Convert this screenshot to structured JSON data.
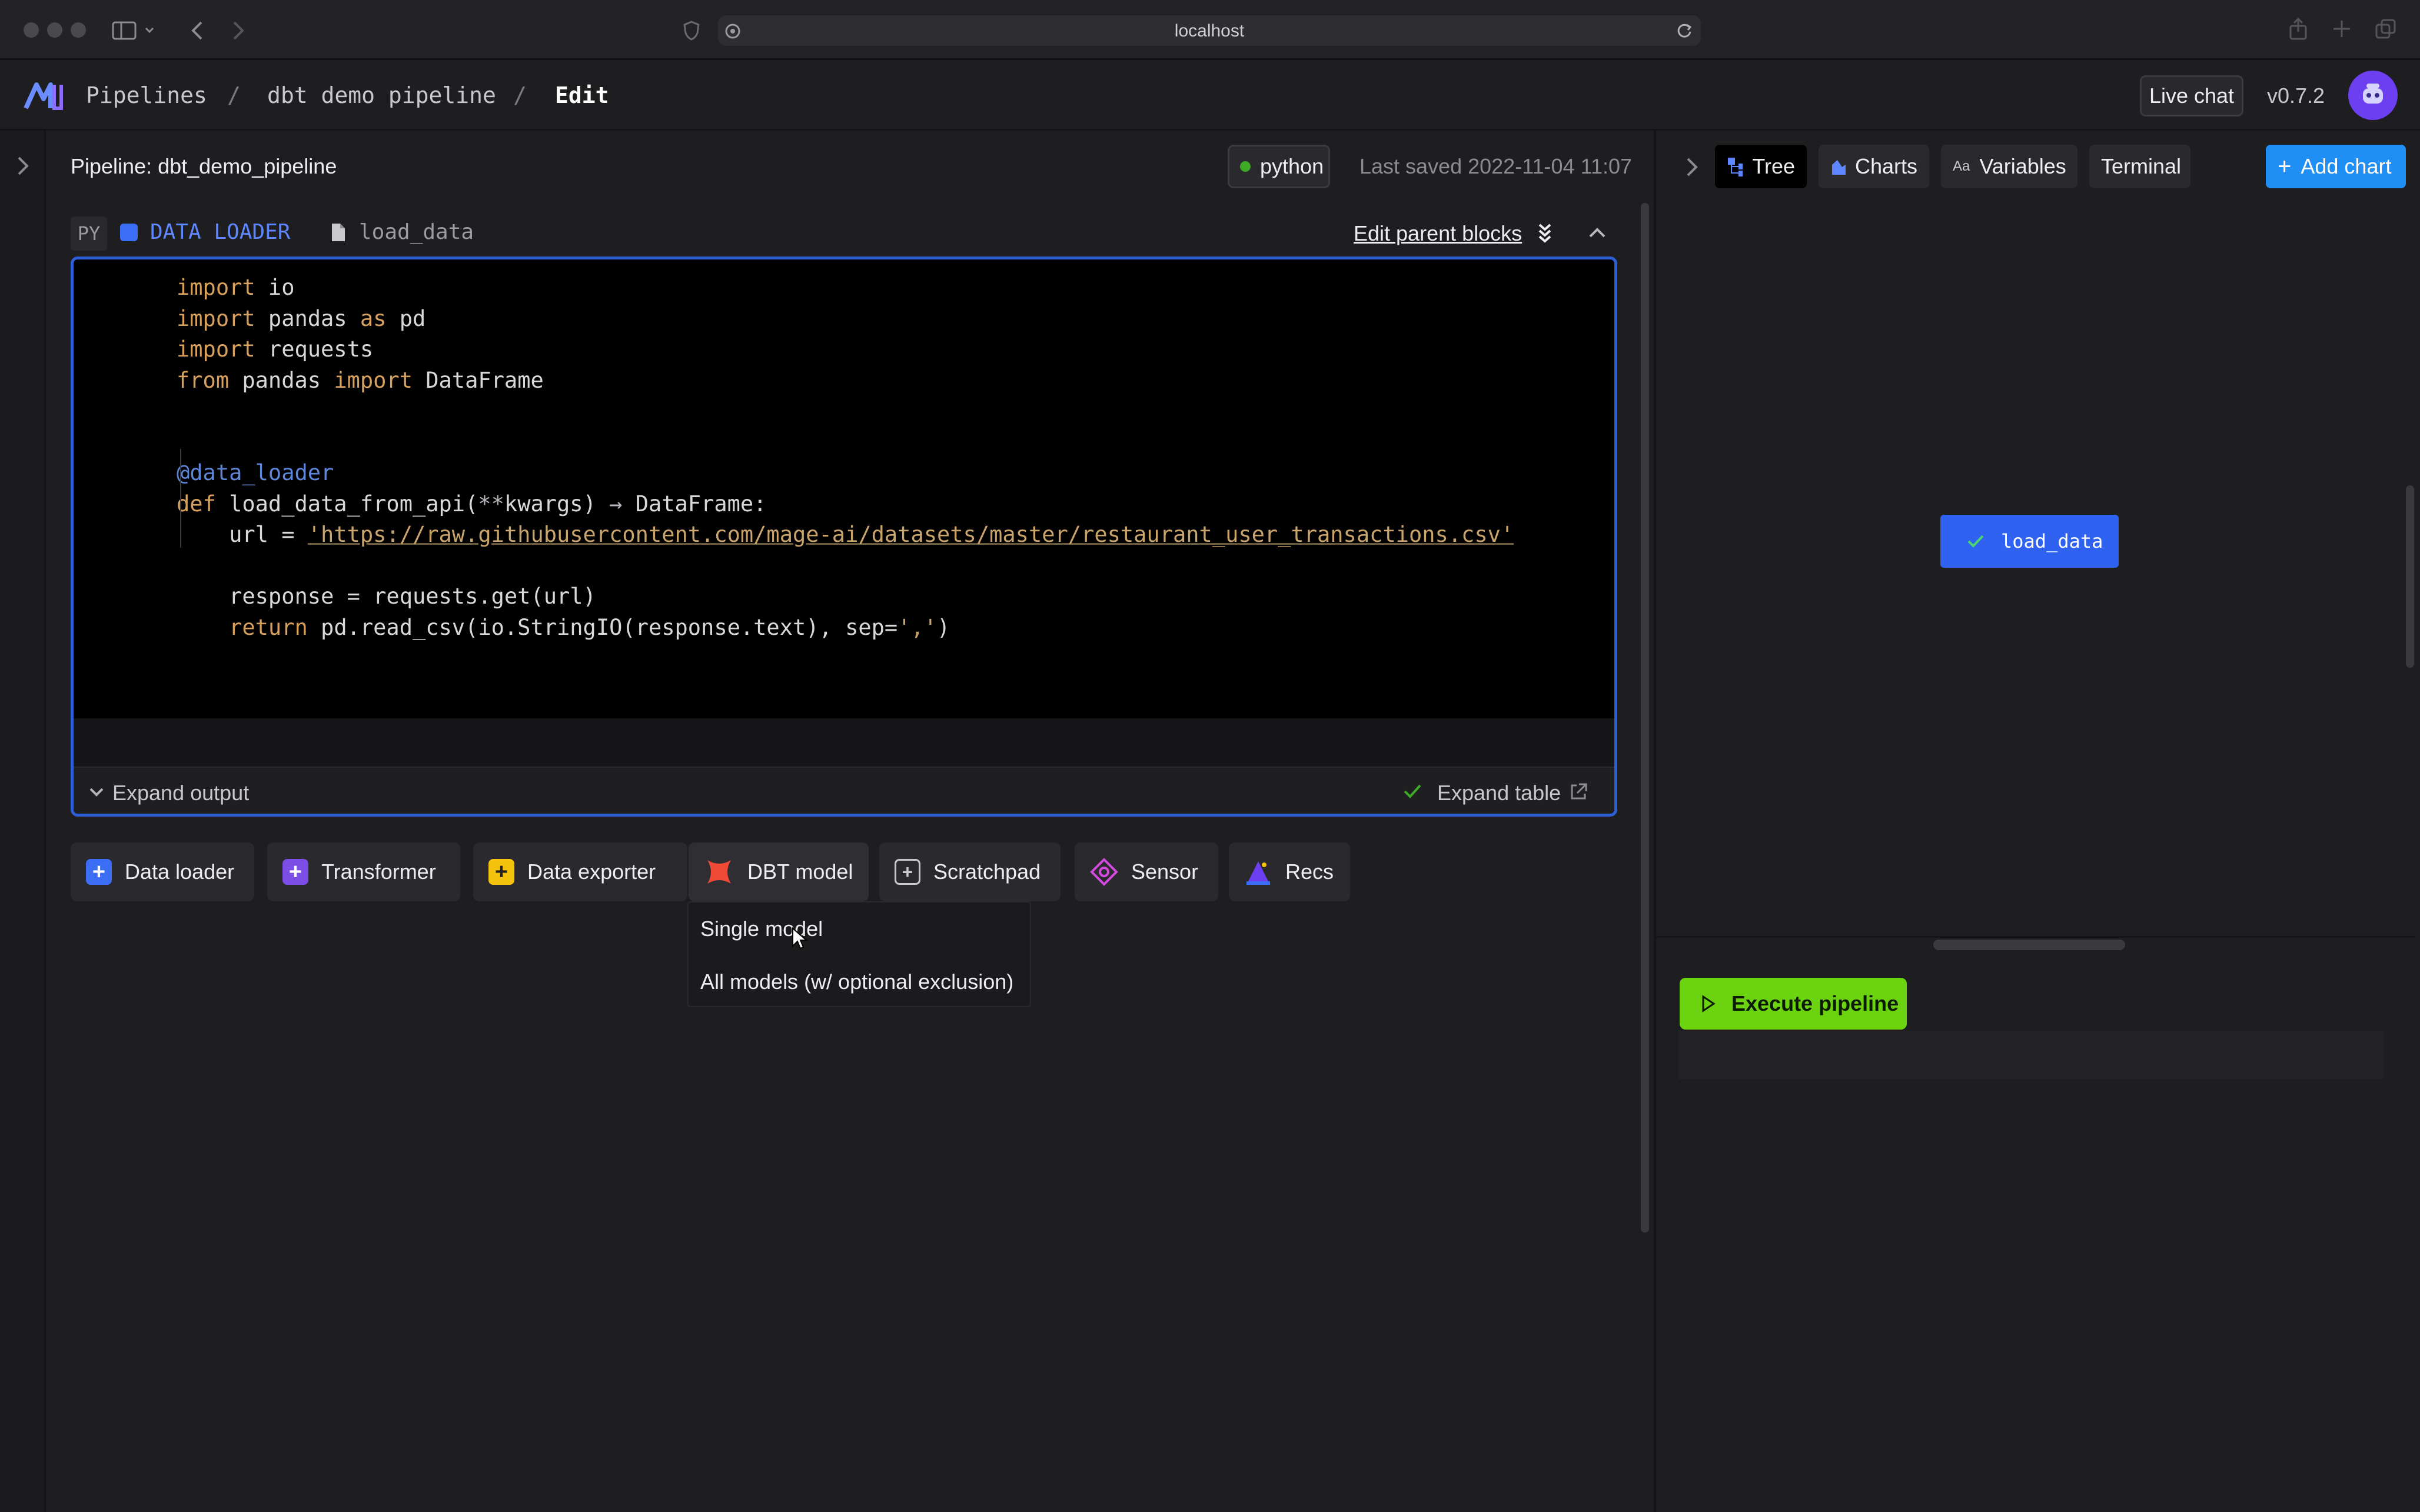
{
  "browser": {
    "url": "localhost"
  },
  "header": {
    "breadcrumbs": [
      "Pipelines",
      "dbt demo pipeline",
      "Edit"
    ],
    "separator": "/",
    "live_chat": "Live chat",
    "version": "v0.7.2"
  },
  "subheader": {
    "pipeline_label": "Pipeline: dbt_demo_pipeline",
    "kernel": "python",
    "last_saved": "Last saved 2022-11-04 11:07"
  },
  "block": {
    "language": "PY",
    "type": "DATA LOADER",
    "name": "load_data",
    "edit_parent": "Edit parent blocks",
    "expand_output": "Expand output",
    "expand_table": "Expand table"
  },
  "code": {
    "lines": [
      "import io",
      "import pandas as pd",
      "import requests",
      "from pandas import DataFrame",
      "",
      "",
      "@data_loader",
      "def load_data_from_api(**kwargs) → DataFrame:",
      "    url = 'https://raw.githubusercontent.com/mage-ai/datasets/master/restaurant_user_transactions.csv'",
      "",
      "    response = requests.get(url)",
      "    return pd.read_csv(io.StringIO(response.text), sep=',')"
    ]
  },
  "add_blocks": {
    "data_loader": "Data loader",
    "transformer": "Transformer",
    "data_exporter": "Data exporter",
    "dbt_model": "DBT model",
    "scratchpad": "Scratchpad",
    "sensor": "Sensor",
    "recs": "Recs"
  },
  "dbt_menu": {
    "single": "Single model",
    "all": "All models (w/ optional exclusion)"
  },
  "right_tabs": {
    "tree": "Tree",
    "charts": "Charts",
    "variables": "Variables",
    "terminal": "Terminal",
    "add_chart": "Add chart"
  },
  "tree": {
    "node": "load_data"
  },
  "execute": {
    "label": "Execute pipeline"
  },
  "colors": {
    "accent_blue": "#2f62f0",
    "execute_green": "#6bd30f",
    "data_loader": "#3b6ef5",
    "transformer": "#7c4ee6",
    "data_exporter": "#f4c20d",
    "dbt": "#f04a36",
    "sensor": "#d44adf"
  }
}
